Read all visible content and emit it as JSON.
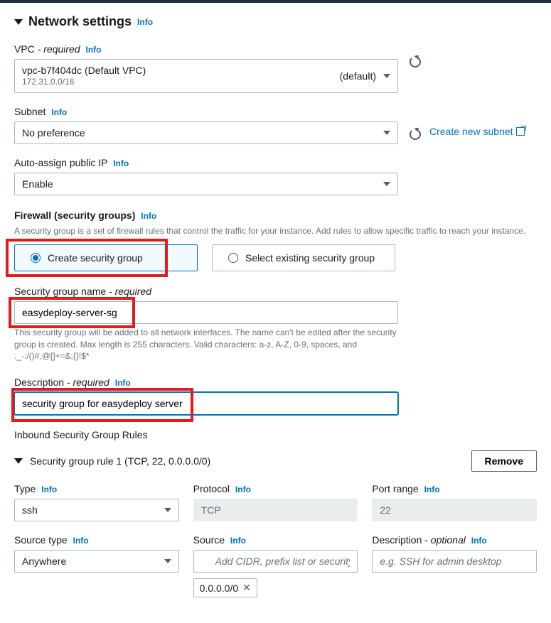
{
  "header": {
    "title": "Network settings",
    "info": "Info"
  },
  "vpc": {
    "label": "VPC",
    "required": "- required",
    "info": "Info",
    "value": "vpc-b7f404dc (Default VPC)",
    "sub": "172.31.0.0/16",
    "default_text": "(default)"
  },
  "subnet": {
    "label": "Subnet",
    "info": "Info",
    "value": "No preference",
    "create_link": "Create new subnet"
  },
  "public_ip": {
    "label": "Auto-assign public IP",
    "info": "Info",
    "value": "Enable"
  },
  "firewall": {
    "label": "Firewall (security groups)",
    "info": "Info",
    "helper": "A security group is a set of firewall rules that control the traffic for your instance. Add rules to allow specific traffic to reach your instance.",
    "create_option": "Create security group",
    "select_option": "Select existing security group"
  },
  "sg_name": {
    "label": "Security group name",
    "required": "- required",
    "value": "easydeploy-server-sg",
    "helper": "This security group will be added to all network interfaces. The name can't be edited after the security group is created. Max length is 255 characters. Valid characters: a-z, A-Z, 0-9, spaces, and ._-:/()#,@[]+=&;{}!$*"
  },
  "sg_desc": {
    "label": "Description",
    "required": "- required",
    "info": "Info",
    "value": "security group for easydeploy server"
  },
  "rules": {
    "title": "Inbound Security Group Rules",
    "rule_label": "Security group rule 1 (TCP, 22, 0.0.0.0/0)",
    "remove": "Remove",
    "type": {
      "label": "Type",
      "info": "Info",
      "value": "ssh"
    },
    "protocol": {
      "label": "Protocol",
      "info": "Info",
      "value": "TCP"
    },
    "port": {
      "label": "Port range",
      "info": "Info",
      "value": "22"
    },
    "source_type": {
      "label": "Source type",
      "info": "Info",
      "value": "Anywhere"
    },
    "source": {
      "label": "Source",
      "info": "Info",
      "placeholder": "Add CIDR, prefix list or security",
      "chip": "0.0.0.0/0"
    },
    "desc": {
      "label": "Description",
      "optional": "- optional",
      "info": "Info",
      "placeholder": "e.g. SSH for admin desktop"
    }
  }
}
